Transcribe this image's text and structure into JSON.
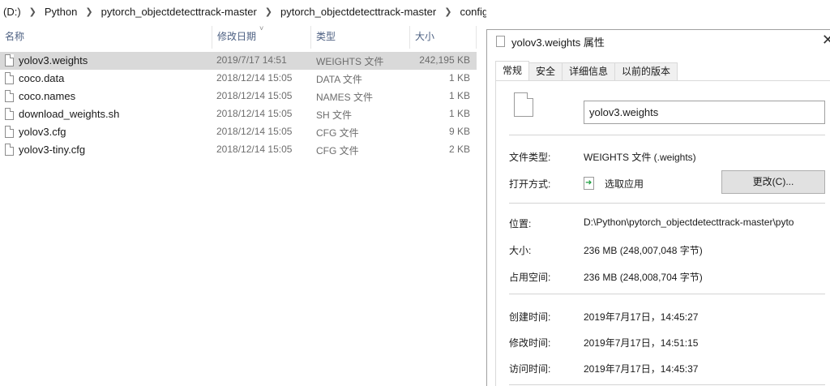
{
  "breadcrumb": {
    "items": [
      "(D:)",
      "Python",
      "pytorch_objectdetecttrack-master",
      "pytorch_objectdetecttrack-master",
      "config"
    ]
  },
  "columns": {
    "name": "名称",
    "modified": "修改日期",
    "type": "类型",
    "size": "大小"
  },
  "files": [
    {
      "name": "yolov3.weights",
      "modified": "2019/7/17 14:51",
      "type": "WEIGHTS 文件",
      "size": "242,195 KB",
      "selected": true
    },
    {
      "name": "coco.data",
      "modified": "2018/12/14 15:05",
      "type": "DATA 文件",
      "size": "1 KB"
    },
    {
      "name": "coco.names",
      "modified": "2018/12/14 15:05",
      "type": "NAMES 文件",
      "size": "1 KB"
    },
    {
      "name": "download_weights.sh",
      "modified": "2018/12/14 15:05",
      "type": "SH 文件",
      "size": "1 KB"
    },
    {
      "name": "yolov3.cfg",
      "modified": "2018/12/14 15:05",
      "type": "CFG 文件",
      "size": "9 KB"
    },
    {
      "name": "yolov3-tiny.cfg",
      "modified": "2018/12/14 15:05",
      "type": "CFG 文件",
      "size": "2 KB"
    }
  ],
  "dialog": {
    "title": "yolov3.weights 属性",
    "tabs": [
      "常规",
      "安全",
      "详细信息",
      "以前的版本"
    ],
    "filename": "yolov3.weights",
    "file_type_label": "文件类型:",
    "file_type_value": "WEIGHTS 文件 (.weights)",
    "open_with_label": "打开方式:",
    "open_with_value": "选取应用",
    "change_button": "更改(C)...",
    "location_label": "位置:",
    "location_value": "D:\\Python\\pytorch_objectdetecttrack-master\\pyto",
    "size_label": "大小:",
    "size_value": "236 MB (248,007,048 字节)",
    "disk_size_label": "占用空间:",
    "disk_size_value": "236 MB (248,008,704 字节)",
    "created_label": "创建时间:",
    "created_value": "2019年7月17日，14:45:27",
    "modified_label": "修改时间:",
    "modified_value": "2019年7月17日，14:51:15",
    "accessed_label": "访问时间:",
    "accessed_value": "2019年7月17日，14:45:37"
  }
}
